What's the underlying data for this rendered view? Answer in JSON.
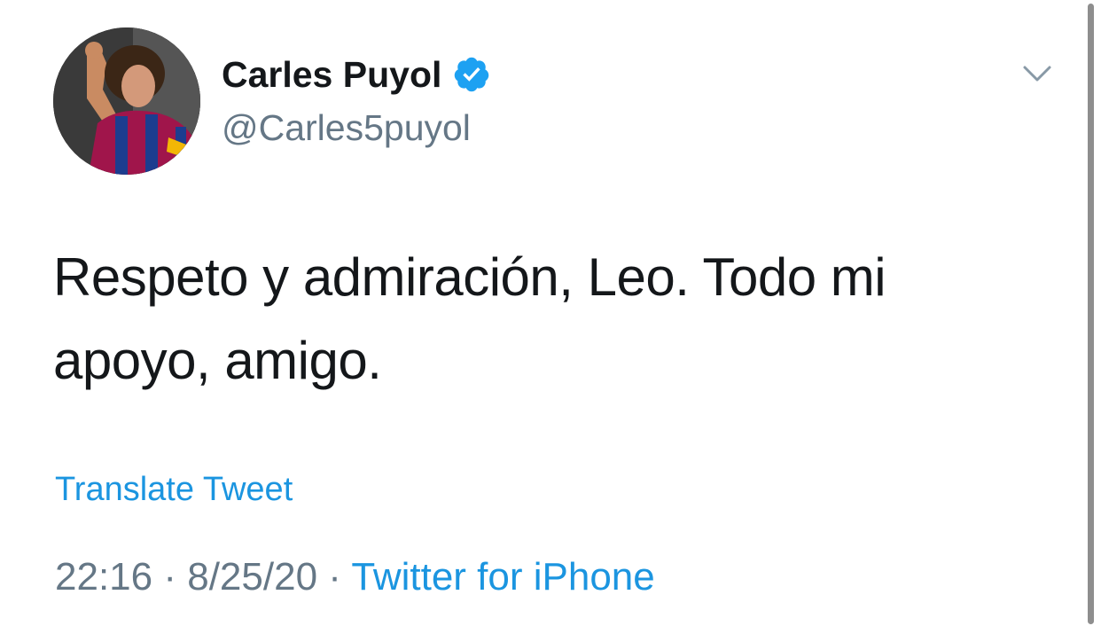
{
  "tweet": {
    "author": {
      "name": "Carles Puyol",
      "handle": "@Carles5puyol",
      "verified": true,
      "avatar_icon": "profile-photo-avatar"
    },
    "text_line_1": "Respeto y admiración, Leo. Todo mi",
    "text_line_2": "apoyo, amigo.",
    "translate_label": "Translate Tweet",
    "time": "22:16",
    "separator": "·",
    "date": "8/25/20",
    "source": "Twitter for iPhone",
    "menu_icon": "chevron-down-icon"
  },
  "colors": {
    "link": "#1b95e0",
    "secondary_text": "#657786",
    "primary_text": "#14171a",
    "verified_badge": "#1da1f2"
  }
}
